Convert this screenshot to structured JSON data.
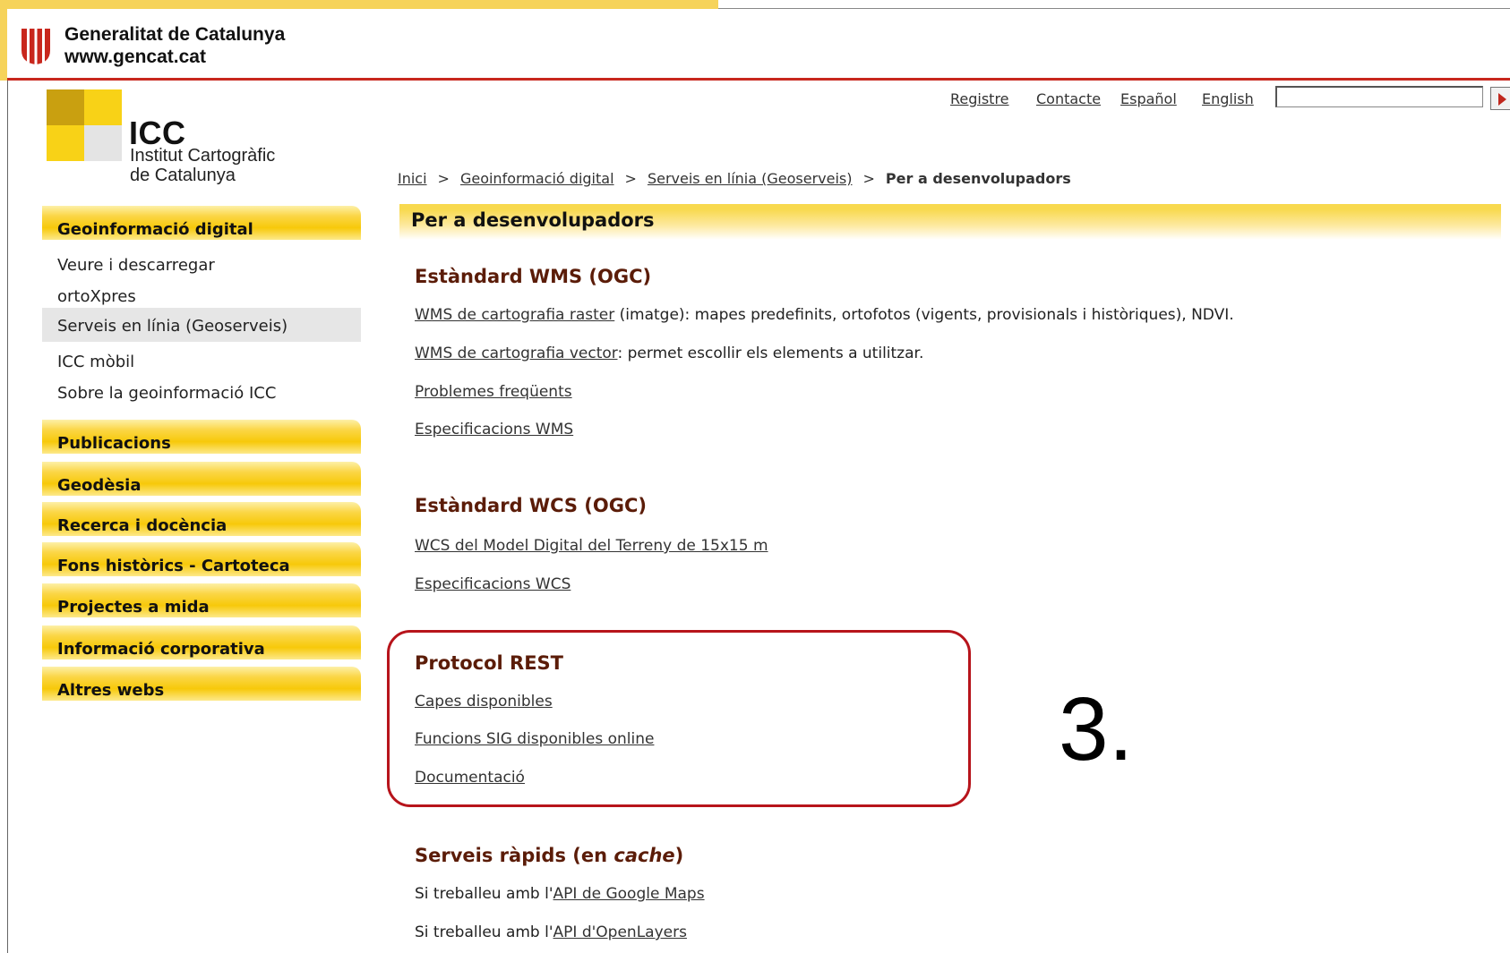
{
  "gencat": {
    "name": "Generalitat de Catalunya",
    "url": "www.gencat.cat"
  },
  "icc": {
    "abbr": "ICC",
    "line1": "Institut Cartogràfic",
    "line2": "de Catalunya"
  },
  "utility": {
    "register": "Registre",
    "contact": "Contacte",
    "spanish": "Español",
    "english": "English",
    "search_value": ""
  },
  "breadcrumb": {
    "items": [
      "Inici",
      "Geoinformació digital",
      "Serveis en línia (Geoserveis)"
    ],
    "separator": ">",
    "current": "Per a desenvolupadors"
  },
  "sidebar": {
    "geoinfo": "Geoinformació digital",
    "sub": [
      "Veure i descarregar",
      "ortoXpres",
      "Serveis en línia (Geoserveis)",
      "ICC mòbil",
      "Sobre la geoinformació ICC"
    ],
    "active_index": 2,
    "sections": [
      "Publicacions",
      "Geodèsia",
      "Recerca i docència",
      "Fons històrics - Cartoteca",
      "Projectes a mida",
      "Informació corporativa",
      "Altres webs"
    ]
  },
  "main": {
    "title": "Per a desenvolupadors",
    "wms": {
      "title": "Estàndard WMS (OGC)",
      "raster_link": "WMS de cartografia raster",
      "raster_text": " (imatge): mapes predefinits, ortofotos (vigents, provisionals i històriques), NDVI.",
      "vector_link": "WMS de cartografia vector",
      "vector_text": ": permet escollir els elements a utilitzar.",
      "problems": "Problemes freqüents",
      "specs": "Especificacions WMS"
    },
    "wcs": {
      "title": "Estàndard WCS (OGC)",
      "mdt": "WCS del Model Digital del Terreny de 15x15 m",
      "specs": "Especificacions WCS"
    },
    "rest": {
      "title": "Protocol REST",
      "layers": "Capes disponibles",
      "sig": "Funcions SIG disponibles online",
      "docs": "Documentació"
    },
    "cache": {
      "title_pre": "Serveis ràpids (en ",
      "title_em": "cache",
      "title_post": ")",
      "google_pre": "Si treballeu amb l'",
      "google_link": "API de Google Maps",
      "ol_pre": "Si treballeu amb l'",
      "ol_link": "API d'OpenLayers"
    }
  },
  "annotation": {
    "label": "3."
  },
  "colors": {
    "accent_yellow": "#f8d94e",
    "gencat_red": "#c8271d",
    "section_title": "#5b1c08",
    "highlight": "#b7141b"
  }
}
